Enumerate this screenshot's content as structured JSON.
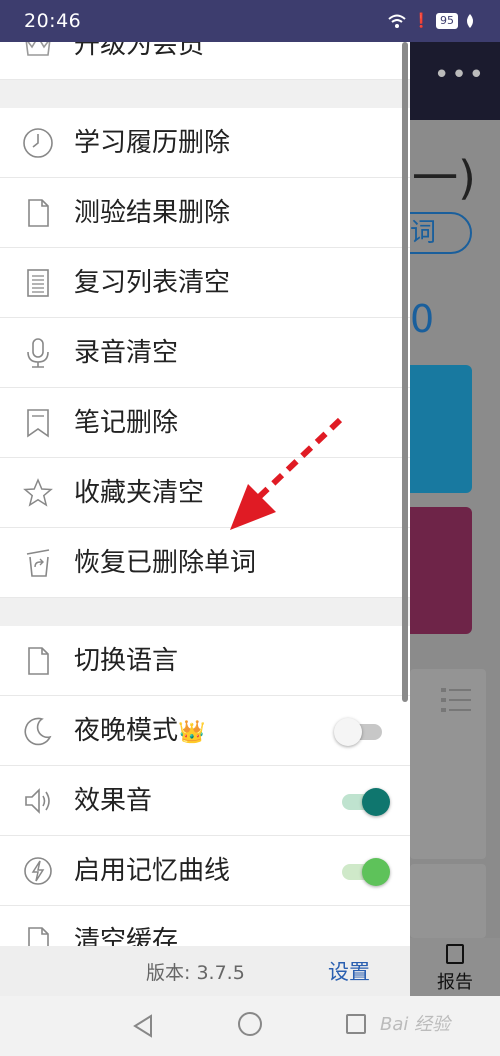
{
  "status_bar": {
    "time": "20:46",
    "battery": "95"
  },
  "background_app": {
    "paren": "一)",
    "pill": "词",
    "zero": "0",
    "report_label": "报告"
  },
  "drawer": {
    "top_item": {
      "label": "升级为会员",
      "icon": "crown-icon"
    },
    "items": [
      {
        "label": "学习履历删除",
        "icon": "clock-icon"
      },
      {
        "label": "测验结果删除",
        "icon": "file-icon"
      },
      {
        "label": "复习列表清空",
        "icon": "list-doc-icon"
      },
      {
        "label": "录音清空",
        "icon": "microphone-icon"
      },
      {
        "label": "笔记删除",
        "icon": "bookmark-icon"
      },
      {
        "label": "收藏夹清空",
        "icon": "star-icon"
      },
      {
        "label": "恢复已删除单词",
        "icon": "restore-trash-icon"
      }
    ],
    "settings_items": [
      {
        "label": "切换语言",
        "icon": "file-icon"
      },
      {
        "label": "夜晚模式",
        "icon": "moon-icon",
        "badge": "👑",
        "toggle": "off"
      },
      {
        "label": "效果音",
        "icon": "speaker-icon",
        "toggle": "on"
      },
      {
        "label": "启用记忆曲线",
        "icon": "lightning-circle-icon",
        "toggle": "on"
      },
      {
        "label": "清空缓存",
        "icon": "file-icon"
      }
    ],
    "footer": {
      "version": "版本: 3.7.5",
      "settings": "设置"
    }
  },
  "nav": {
    "watermark": "Bai 经验"
  }
}
